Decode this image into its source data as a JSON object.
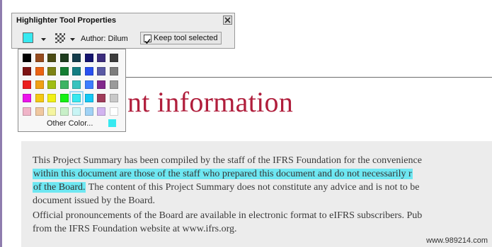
{
  "toolbar": {
    "title": "Highlighter Tool Properties",
    "author_label": "Author: Dilum",
    "keep_tool_label": "Keep tool selected",
    "keep_tool_checked": true,
    "current_color": "#37e9f0"
  },
  "palette": {
    "colors": [
      [
        "#000000",
        "#964b1e",
        "#4b4b14",
        "#1e3c1e",
        "#143c4b",
        "#14146e",
        "#3c2d7d",
        "#3c3c3c"
      ],
      [
        "#7d1414",
        "#eb6414",
        "#7d8214",
        "#147d32",
        "#147d82",
        "#2850f0",
        "#5a5aa5",
        "#7d7d7d"
      ],
      [
        "#eb1e1e",
        "#f0a014",
        "#a0be14",
        "#3cb464",
        "#37c3be",
        "#3c7dff",
        "#82288c",
        "#9b9b9b"
      ],
      [
        "#eb14eb",
        "#f5c814",
        "#f0f014",
        "#14f014",
        "#37e9f0",
        "#14c8f5",
        "#a03c5a",
        "#c8c8c8"
      ],
      [
        "#f0b4c8",
        "#f0c8a0",
        "#f5f5a0",
        "#c8f0c8",
        "#c8f5f5",
        "#a0d2f5",
        "#d2b4f0",
        "#ffffff"
      ]
    ],
    "selected": "#37e9f0",
    "other_label": "Other Color...",
    "other_color": "#37e9f0"
  },
  "document": {
    "heading": "nt information",
    "para1_lines": [
      {
        "text": "This Project Summary has been compiled by the staff of the IFRS Foundation for the convenience",
        "hl": ""
      },
      {
        "text": "",
        "hl": "within this document are those of the staff who prepared this document and do not necessarily r"
      },
      {
        "text": " The content of this Project Summary does not constitute any advice and is not to be",
        "hl": "of the Board."
      },
      {
        "text": "document issued by the Board.",
        "hl": ""
      }
    ],
    "para2_lines": [
      "Official pronouncements of the Board are available in electronic format to eIFRS subscribers.  Pub",
      "from the IFRS Foundation website at www.ifrs.org."
    ],
    "highlight_color": "#6ee7f2"
  },
  "watermark": "www.989214.com"
}
